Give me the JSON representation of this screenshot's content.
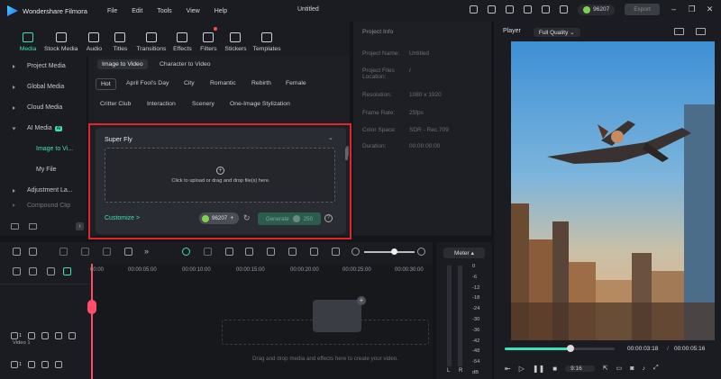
{
  "app": {
    "name": "Wondershare Filmora",
    "title": "Untitled",
    "menu": [
      "File",
      "Edit",
      "Tools",
      "View",
      "Help"
    ],
    "coins": "96207",
    "export_label": "Export"
  },
  "toolbar": [
    {
      "label": "Media",
      "icon": "media-icon",
      "active": true
    },
    {
      "label": "Stock Media",
      "icon": "stock-media-icon"
    },
    {
      "label": "Audio",
      "icon": "audio-icon"
    },
    {
      "label": "Titles",
      "icon": "titles-icon"
    },
    {
      "label": "Transitions",
      "icon": "transitions-icon"
    },
    {
      "label": "Effects",
      "icon": "effects-icon"
    },
    {
      "label": "Filters",
      "icon": "filters-icon"
    },
    {
      "label": "Stickers",
      "icon": "stickers-icon"
    },
    {
      "label": "Templates",
      "icon": "templates-icon"
    }
  ],
  "sidebar": {
    "items": [
      {
        "label": "Project Media"
      },
      {
        "label": "Global Media"
      },
      {
        "label": "Cloud Media"
      },
      {
        "label": "AI Media",
        "badge": "AI"
      },
      {
        "label": "Image to Vi..."
      },
      {
        "label": "My File"
      },
      {
        "label": "Adjustment La..."
      },
      {
        "label": "Compound Clip"
      }
    ]
  },
  "media": {
    "tabs": [
      "Image to Video",
      "Character to Video"
    ],
    "categories_row1": [
      "Hot",
      "April Fool's Day",
      "City",
      "Romantic",
      "Rebirth",
      "Female"
    ],
    "categories_row2": [
      "Critter Club",
      "Interaction",
      "Scenery",
      "One-Image Stylization"
    ]
  },
  "modal": {
    "template": "Super Fly",
    "upload_text": "Click to upload or drag and drop file(s) here.",
    "customize": "Customize >",
    "credits": "96207",
    "generate": "Generate",
    "generate_cost": "250"
  },
  "project_info": {
    "title": "Project Info",
    "rows": [
      {
        "k": "Project Name:",
        "v": "Untitled"
      },
      {
        "k": "Project Files Location:",
        "v": "/"
      },
      {
        "k": "Resolution:",
        "v": "1080 x 1920"
      },
      {
        "k": "Frame Rate:",
        "v": "25fps"
      },
      {
        "k": "Color Space:",
        "v": "SDR - Rec.709"
      },
      {
        "k": "Duration:",
        "v": "00:00:00:00"
      }
    ]
  },
  "player": {
    "label": "Player",
    "quality": "Full Quality",
    "current": "00:00:03:18",
    "total": "00:00:05:16",
    "ratio": "9:16",
    "progress": 0.6
  },
  "timeline": {
    "ruler": [
      "00:00",
      "00:00:05:00",
      "00:00:10:00",
      "00:00:15:00",
      "00:00:20:00",
      "00:00:25:00",
      "00:00:30:00"
    ],
    "drop_text": "Drag and drop media and effects here to create your video.",
    "track_name": "Video 1",
    "track1": "1",
    "track2": "1"
  },
  "meter": {
    "title": "Meter",
    "levels": [
      "0",
      "-6",
      "-12",
      "-18",
      "-24",
      "-30",
      "-36",
      "-42",
      "-48",
      "-54"
    ],
    "unit": "dB",
    "left": "L",
    "right": "R"
  },
  "colors": {
    "accent": "#3fe0b5",
    "highlight": "#e0262c"
  }
}
